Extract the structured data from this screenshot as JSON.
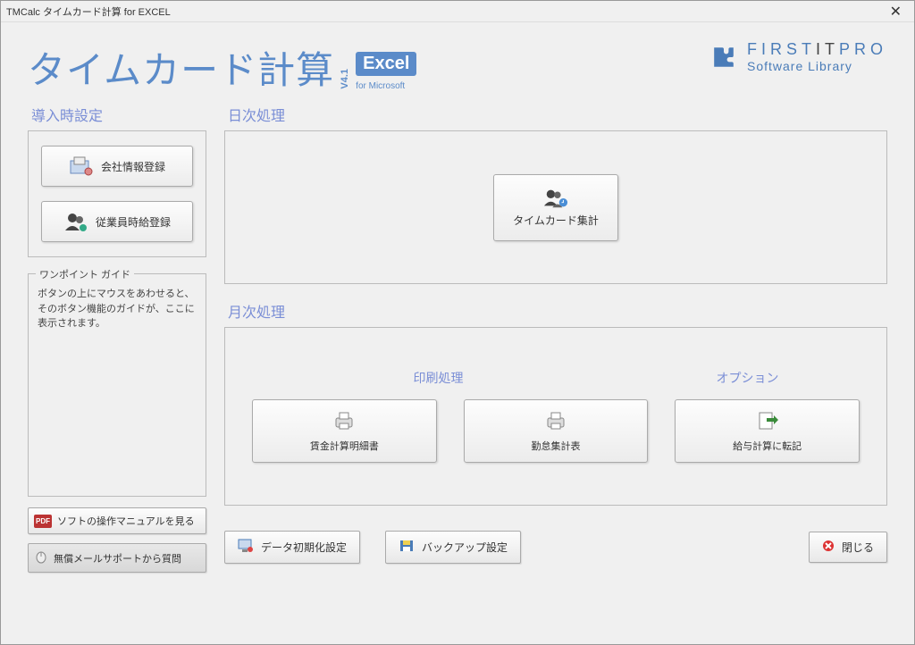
{
  "window": {
    "title": "TMCalc タイムカード計算 for EXCEL"
  },
  "header": {
    "app_title": "タイムカード計算",
    "version": "V4.1",
    "excel_badge": "Excel",
    "for_text": "for Microsoft"
  },
  "brand": {
    "line1a": "FIRST",
    "line1b": "IT",
    "line1c": "PRO",
    "line2": "Software Library"
  },
  "sections": {
    "setup": "導入時設定",
    "daily": "日次処理",
    "monthly": "月次処理",
    "print": "印刷処理",
    "option": "オプション"
  },
  "buttons": {
    "company_reg": "会社情報登録",
    "employee_reg": "従業員時給登録",
    "timecard_agg": "タイムカード集計",
    "wage_detail": "賃金計算明細書",
    "attendance_sum": "勤怠集計表",
    "salary_post": "給与計算に転記",
    "manual": "ソフトの操作マニュアルを見る",
    "support": "無償メールサポートから質問",
    "data_init": "データ初期化設定",
    "backup": "バックアップ設定",
    "close": "閉じる"
  },
  "guide": {
    "title": "ワンポイント ガイド",
    "text": "ボタンの上にマウスをあわせると、そのボタン機能のガイドが、ここに表示されます。"
  },
  "icons": {
    "pdf": "PDF"
  }
}
